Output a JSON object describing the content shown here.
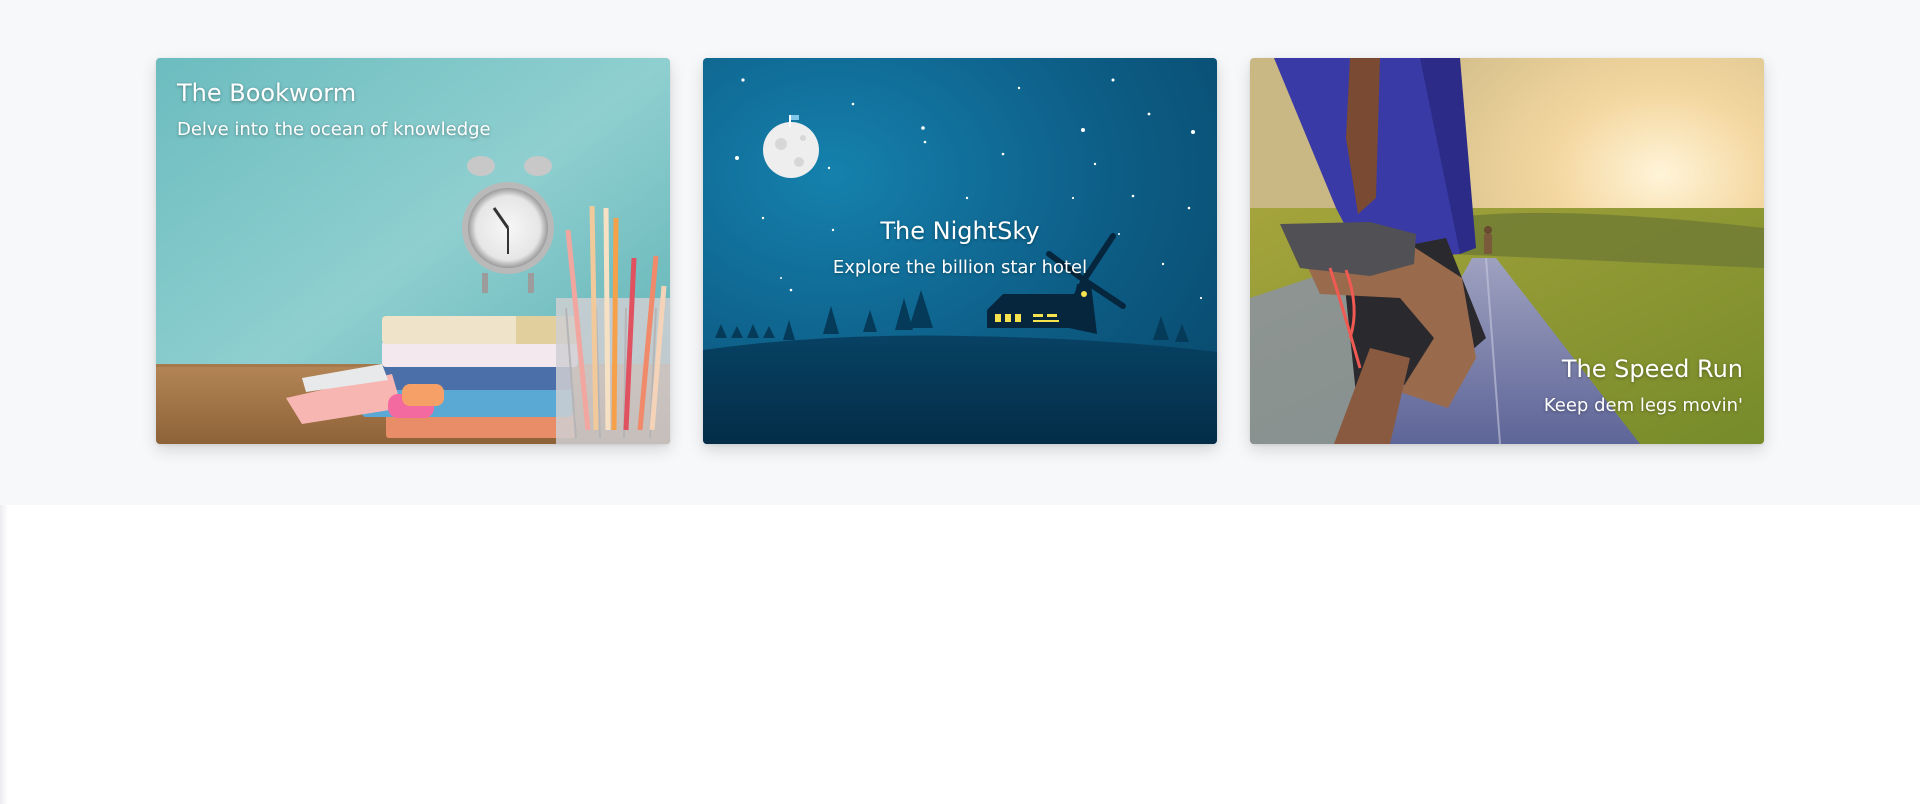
{
  "cards": [
    {
      "title": "The Bookworm",
      "subtitle": "Delve into the ocean of knowledge",
      "colors": {
        "background": "#7fc8c9",
        "desk": "#b9895a"
      }
    },
    {
      "title": "The NightSky",
      "subtitle": "Explore the billion star hotel",
      "colors": {
        "sky": "#0e5f86",
        "ground": "#063049"
      }
    },
    {
      "title": "The Speed Run",
      "subtitle": "Keep dem legs movin'",
      "colors": {
        "sky": "#f1d6a6",
        "road": "#6d75a8",
        "shirt": "#3b3a9f"
      }
    }
  ]
}
